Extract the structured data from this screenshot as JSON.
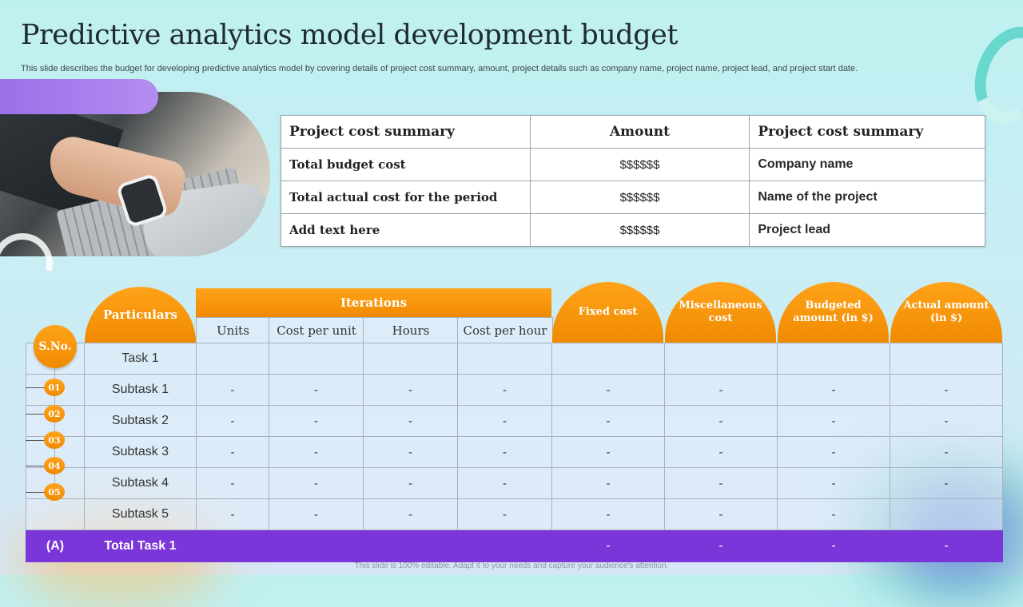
{
  "title": "Predictive analytics model development budget",
  "subtitle": "This slide describes the budget for developing predictive analytics model by covering details of project cost summary, amount, project details such as company name, project name, project lead, and project start date.",
  "footer": "This slide is 100% editable. Adapt it to your needs and capture your audience's attention.",
  "summary_table": {
    "headers": [
      "Project cost summary",
      "Amount",
      "Project cost summary"
    ],
    "rows": [
      {
        "label": "Total budget cost",
        "amount": "$$$$$$",
        "detail": "Company name"
      },
      {
        "label": "Total actual cost for the period",
        "amount": "$$$$$$",
        "detail": "Name of the project"
      },
      {
        "label": "Add text here",
        "amount": "$$$$$$",
        "detail": "Project lead"
      }
    ]
  },
  "budget_table": {
    "sno_header": "S.No.",
    "particulars_header": "Particulars",
    "iterations_header": "Iterations",
    "iteration_columns": [
      "Units",
      "Cost per unit",
      "Hours",
      "Cost per hour"
    ],
    "other_headers": [
      "Fixed cost",
      "Miscellaneous cost",
      "Budgeted amount (in $)",
      "Actual amount (in $)"
    ],
    "task_row": "Task 1",
    "rows": [
      {
        "num": "01",
        "name": "Subtask 1",
        "values": [
          "-",
          "-",
          "-",
          "-",
          "-",
          "-",
          "-",
          "-"
        ]
      },
      {
        "num": "02",
        "name": "Subtask 2",
        "values": [
          "-",
          "-",
          "-",
          "-",
          "-",
          "-",
          "-",
          "-"
        ]
      },
      {
        "num": "03",
        "name": "Subtask 3",
        "values": [
          "-",
          "-",
          "-",
          "-",
          "-",
          "-",
          "-",
          "-"
        ]
      },
      {
        "num": "04",
        "name": "Subtask 4",
        "values": [
          "-",
          "-",
          "-",
          "-",
          "-",
          "-",
          "-",
          "-"
        ]
      },
      {
        "num": "05",
        "name": "Subtask 5",
        "values": [
          "-",
          "-",
          "-",
          "-",
          "-",
          "-",
          "-",
          ""
        ]
      }
    ],
    "total": {
      "sno": "(A)",
      "name": "Total Task 1",
      "values": [
        "",
        "",
        "",
        "",
        "-",
        "-",
        "-",
        "-"
      ]
    }
  },
  "colors": {
    "accent_orange": "#f7960e",
    "accent_purple": "#7a36d8",
    "teal": "#5fd6cc"
  }
}
